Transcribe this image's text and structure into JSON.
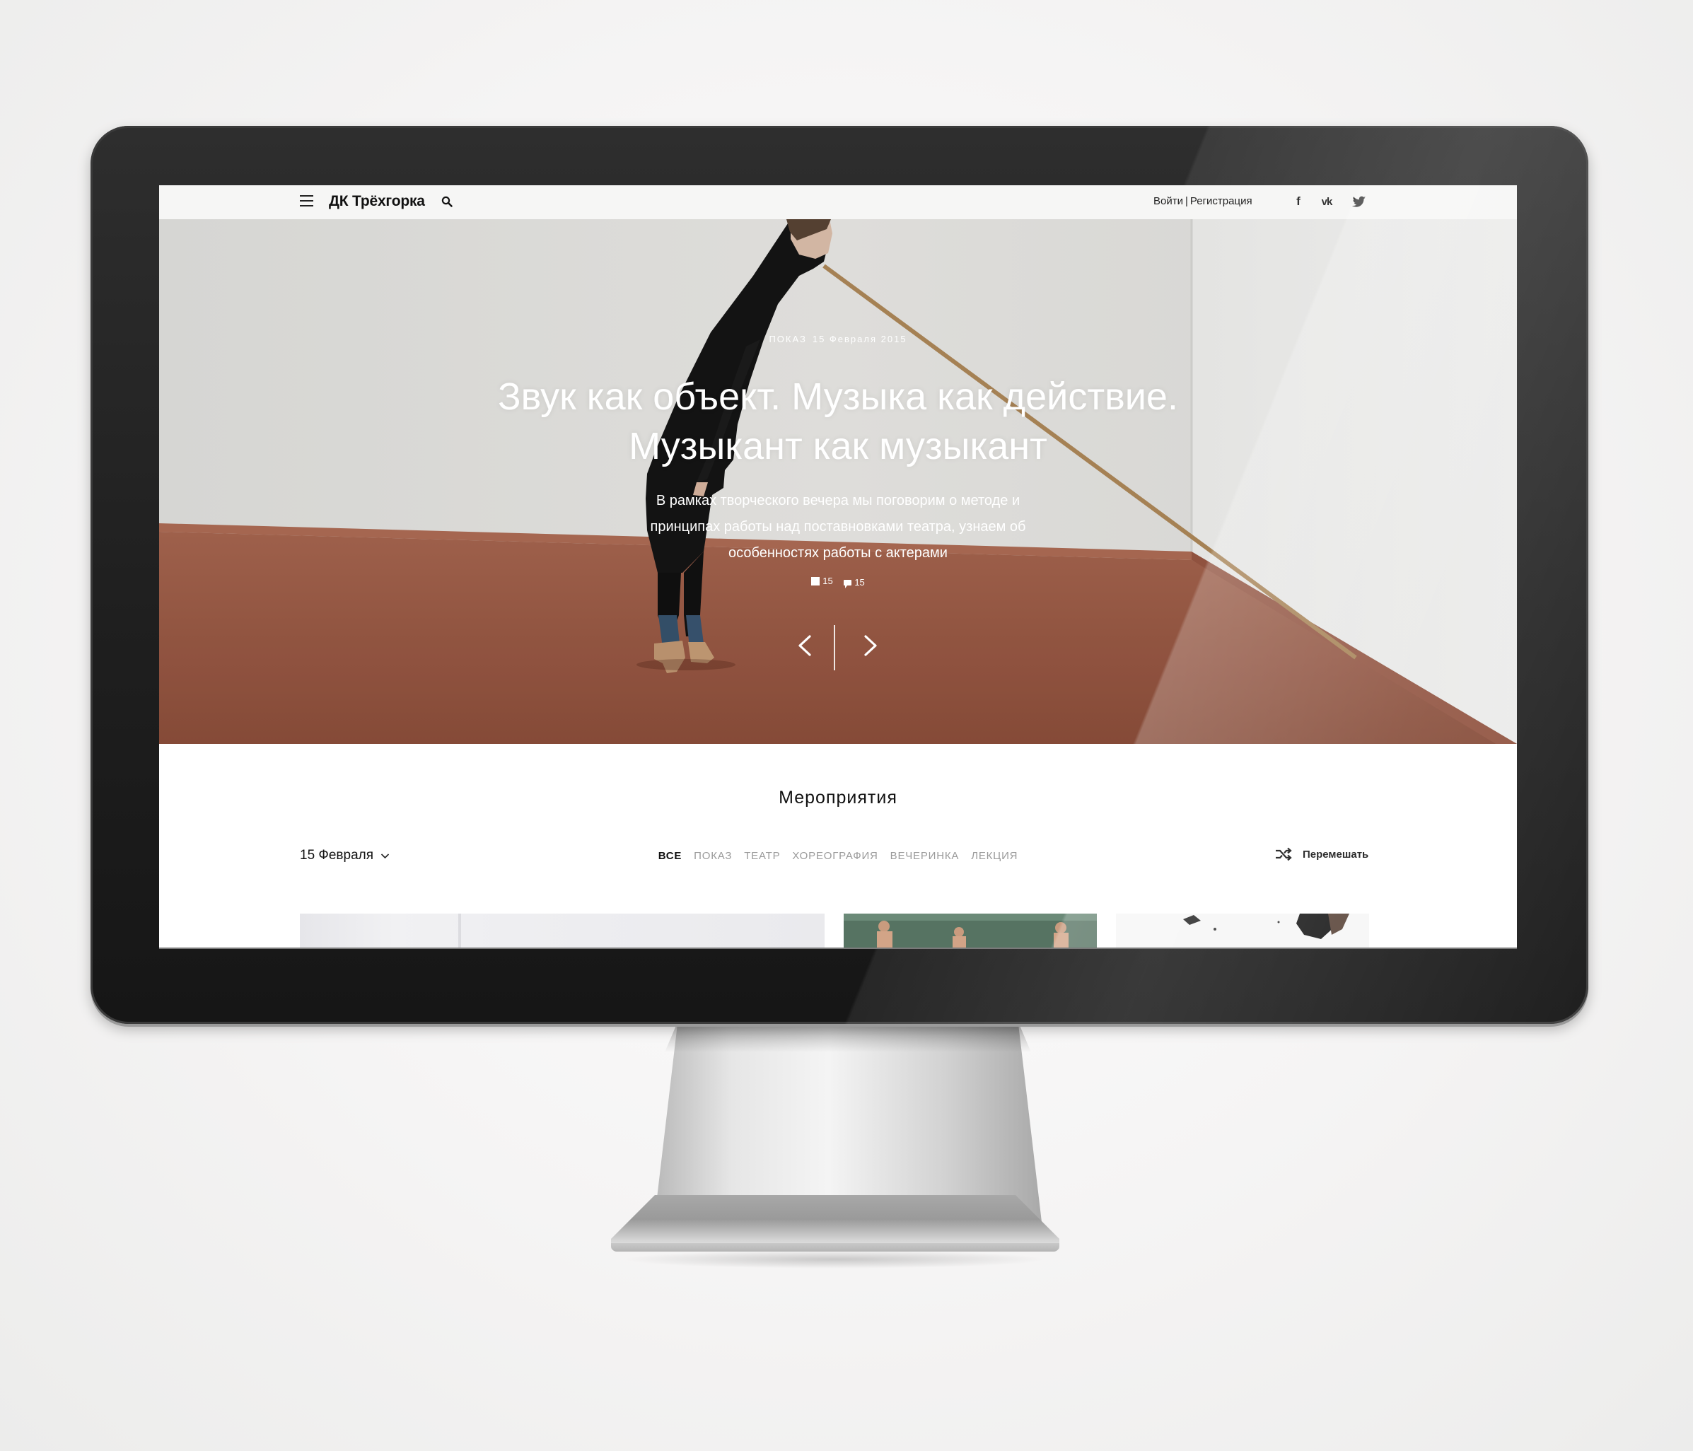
{
  "header": {
    "logo": "ДК Трёхгорка",
    "login": "Войти",
    "separator": "|",
    "register": "Регистрация",
    "social": [
      "facebook-icon",
      "vk-icon",
      "twitter-icon"
    ],
    "social_fb_glyph": "f",
    "social_vk_glyph": "vk"
  },
  "hero": {
    "category": "ПОКАЗ",
    "date": "15 Февраля 2015",
    "title_line1": "Звук как объект. Музыка как действие.",
    "title_line2": "Музыкант как музыкант",
    "description": "В рамках творческого вечера мы поговорим о методе и принципах работы над поставновками театра, узнаем об особенностях работы с актерами",
    "photos_count": "15",
    "comments_count": "15"
  },
  "events": {
    "title": "Мероприятия",
    "date_filter": "15 Февраля",
    "tabs": [
      {
        "label": "ВСЕ",
        "active": true
      },
      {
        "label": "ПОКАЗ",
        "active": false
      },
      {
        "label": "ТЕАТР",
        "active": false
      },
      {
        "label": "ХОРЕОГРАФИЯ",
        "active": false
      },
      {
        "label": "ВЕЧЕРИНКА",
        "active": false
      },
      {
        "label": "ЛЕКЦИЯ",
        "active": false
      }
    ],
    "shuffle_label": "Перемешать"
  },
  "colors": {
    "active_text": "#111111",
    "inactive_tab": "#9a9a9a",
    "header_bg": "#f6f6f5",
    "floor": "#9c5a44",
    "wall": "#e9e9e6"
  }
}
